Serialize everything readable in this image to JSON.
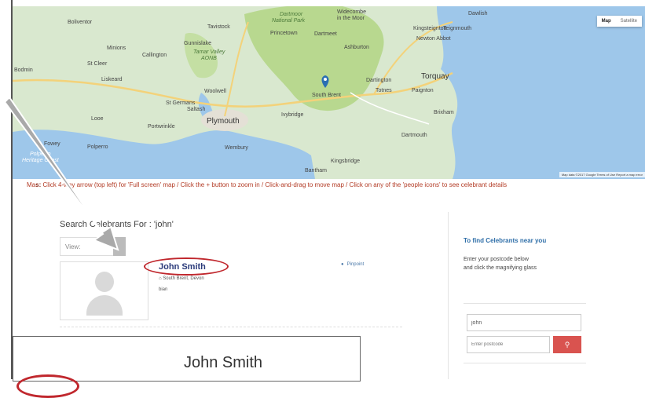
{
  "map": {
    "map_type": {
      "map": "Map",
      "satellite": "Satellite"
    },
    "footer": "Map data ©2017 Google   Terms of Use   Report a map error",
    "labels": {
      "boliventor": "Boliventor",
      "tavistock": "Tavistock",
      "dartmoor": "Dartmoor",
      "national_park": "National Park",
      "widecombe": "Widecombe",
      "in_the_moor": "in the Moor",
      "princetown": "Princetown",
      "dartmeet": "Dartmeet",
      "dawlish": "Dawlish",
      "kingsteignton": "Kingsteignton",
      "teignmouth": "Teignmouth",
      "newton_abbot": "Newton Abbot",
      "minions": "Minions",
      "callington": "Callington",
      "gunnislake": "Gunnislake",
      "tamar_valley": "Tamar Valley",
      "aonb": "AONB",
      "ashburton": "Ashburton",
      "st_cleer": "St Cleer",
      "bodmin": "Bodmin",
      "liskeard": "Liskeard",
      "woolwell": "Woolwell",
      "south_brent": "South Brent",
      "dartington": "Dartington",
      "totnes": "Totnes",
      "torquay": "Torquay",
      "paignton": "Paignton",
      "st_germans": "St Germans",
      "saltash": "Saltash",
      "plymouth": "Plymouth",
      "ivybridge": "Ivybridge",
      "brixham": "Brixham",
      "looe": "Looe",
      "portwrinkle": "Portwrinkle",
      "dartmouth": "Dartmouth",
      "fowey": "Fowey",
      "polperro": "Polperro",
      "polperro_heritage": "Polperro",
      "heritage_coast": "Heritage Coast",
      "wembury": "Wembury",
      "kingsbridge": "Kingsbridge",
      "bantham": "Bantham"
    }
  },
  "instructions": {
    "prefix": "Ma",
    "bold": "s:",
    "text": " Click 4-way arrow (top left) for 'Full screen' map  /  Click the + button to zoom in  /  Click-and-drag to move map  /  Click on any of the 'people icons' to see celebrant details"
  },
  "results": {
    "title": "Search Celebrants For : 'john'",
    "view_label": "View:",
    "result": {
      "name": "John Smith",
      "location": "South Brent, Devon",
      "role": "bian",
      "pinpoint": "Pinpoint"
    }
  },
  "sidebar": {
    "title": "To find Celebrants near you",
    "text_line1": "Enter your postcode below",
    "text_line2": "and click the magnifying glass",
    "query_value": "john",
    "postcode_placeholder": "Enter postcode",
    "search_icon": "magnifier-icon"
  },
  "zoom": {
    "name": "John Smith"
  },
  "colors": {
    "accent_red": "#d9534f",
    "ring_red": "#c0272d",
    "link_blue": "#2e6ea8",
    "sea": "#9ec7ea",
    "moor": "#b8d88f"
  }
}
